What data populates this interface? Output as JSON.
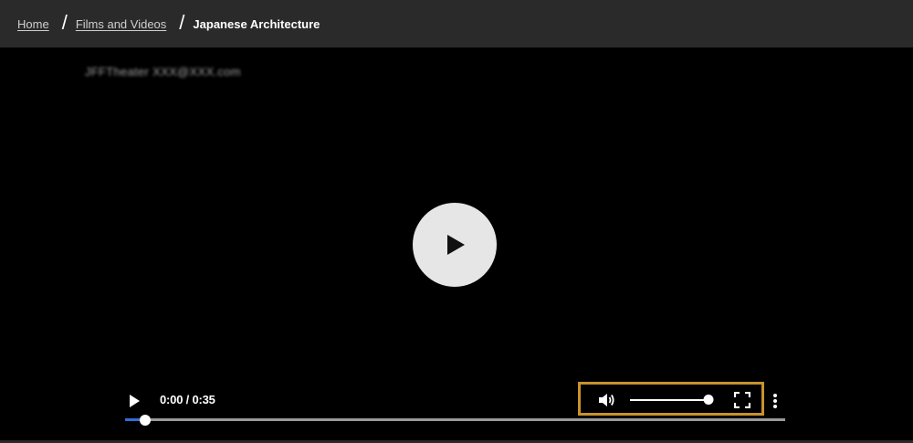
{
  "breadcrumb": {
    "items": [
      {
        "label": "Home"
      },
      {
        "label": "Films and Videos"
      }
    ],
    "separator": "/",
    "current": "Japanese Architecture"
  },
  "video": {
    "watermark": "JFFTheater XXX@XXX.com",
    "big_play_icon": "play-icon",
    "time_display": "0:00 / 0:35",
    "progress_fraction": 0.03,
    "volume_fraction": 0.95,
    "icons": {
      "play": "play-icon",
      "volume": "volume-icon",
      "fullscreen": "fullscreen-icon",
      "more": "more-vertical-icon"
    }
  },
  "colors": {
    "header_bg": "#2a2a2a",
    "highlight": "#c8922a",
    "progress_played": "#2f6fd6"
  }
}
